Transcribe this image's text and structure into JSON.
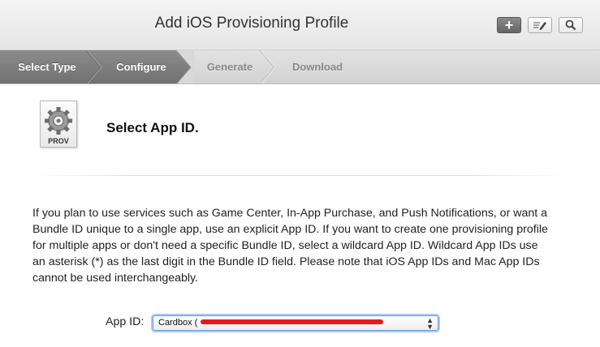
{
  "header": {
    "title": "Add iOS Provisioning Profile",
    "buttons": [
      {
        "name": "add-button",
        "icon": "plus-icon"
      },
      {
        "name": "edit-button",
        "icon": "edit-icon"
      },
      {
        "name": "search-button",
        "icon": "search-icon"
      }
    ]
  },
  "steps": [
    {
      "label": "Select Type",
      "state": "done"
    },
    {
      "label": "Configure",
      "state": "current"
    },
    {
      "label": "Generate",
      "state": "upcoming"
    },
    {
      "label": "Download",
      "state": "upcoming"
    }
  ],
  "profile_icon": {
    "label": "PROV",
    "icon": "gear-icon"
  },
  "section": {
    "title": "Select App ID.",
    "description": "If you plan to use services such as Game Center, In-App Purchase, and Push Notifications, or want a Bundle ID unique to a single app, use an explicit App ID. If you want to create one provisioning profile for multiple apps or don't need a specific Bundle ID, select a wildcard App ID. Wildcard App IDs use an asterisk (*) as the last digit in the Bundle ID field. Please note that iOS App IDs and Mac App IDs cannot be used interchangeably."
  },
  "app_id": {
    "label": "App ID:",
    "selected": "Cardbox (",
    "redacted": true
  },
  "colors": {
    "step_active": "#7a7a7a",
    "focus_ring": "#6a9fe8",
    "redaction": "#e01c1c"
  }
}
